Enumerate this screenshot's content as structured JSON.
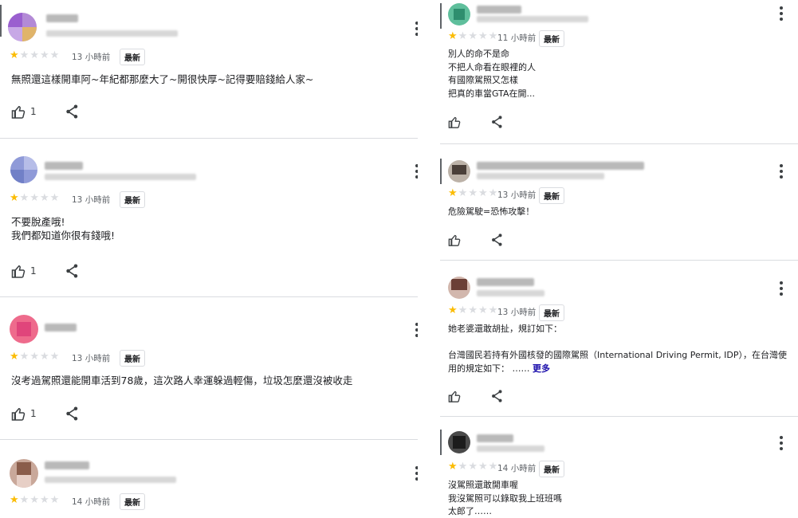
{
  "icons": {
    "like": "thumbs-up-icon",
    "share": "share-icon",
    "menu": "more-vert-icon",
    "star": "star-icon"
  },
  "colors": {
    "star_on": "#fbbc04",
    "star_off": "#dadce0",
    "more_link": "#1a0dab",
    "divider": "#dadce0"
  },
  "left_reviews": [
    {
      "rating": 1,
      "time": "13 小時前",
      "badge": "最新",
      "lines": [
        "無照還這樣開車阿~年紀都那麼大了~開很快厚~記得要賠錢給人家~"
      ],
      "likes": "1"
    },
    {
      "rating": 1,
      "time": "13 小時前",
      "badge": "最新",
      "lines": [
        "不要脫產哦!",
        "我們都知道你很有錢哦!"
      ],
      "likes": "1"
    },
    {
      "rating": 1,
      "time": "13 小時前",
      "badge": "最新",
      "lines": [
        "沒考過駕照還能開車活到78歲，這次路人幸運躲過輕傷，垃圾怎麼還沒被收走"
      ],
      "likes": "1"
    },
    {
      "rating": 1,
      "time": "14 小時前",
      "badge": "最新",
      "lines": [],
      "likes": ""
    }
  ],
  "right_reviews": [
    {
      "rating": 1,
      "time": "11 小時前",
      "badge": "最新",
      "lines": [
        "別人的命不是命",
        "不把人命看在眼裡的人",
        "有國際駕照又怎樣",
        "把真的車當GTA在開..."
      ]
    },
    {
      "rating": 1,
      "time": "13 小時前",
      "badge": "最新",
      "lines": [
        "危險駕駛=恐怖攻擊！"
      ]
    },
    {
      "rating": 1,
      "time": "13 小時前",
      "badge": "最新",
      "lines": [
        "她老婆還敢胡扯，規訂如下：",
        "",
        "台灣國民若持有外國核發的國際駕照（International Driving Permit, IDP），在台灣使",
        "用的規定如下： ……"
      ],
      "more": "更多"
    },
    {
      "rating": 1,
      "time": "14 小時前",
      "badge": "最新",
      "lines": [
        "沒駕照還敢開車喔",
        "我沒駕照可以錄取我上班班嗎",
        "太郎了……"
      ]
    }
  ]
}
